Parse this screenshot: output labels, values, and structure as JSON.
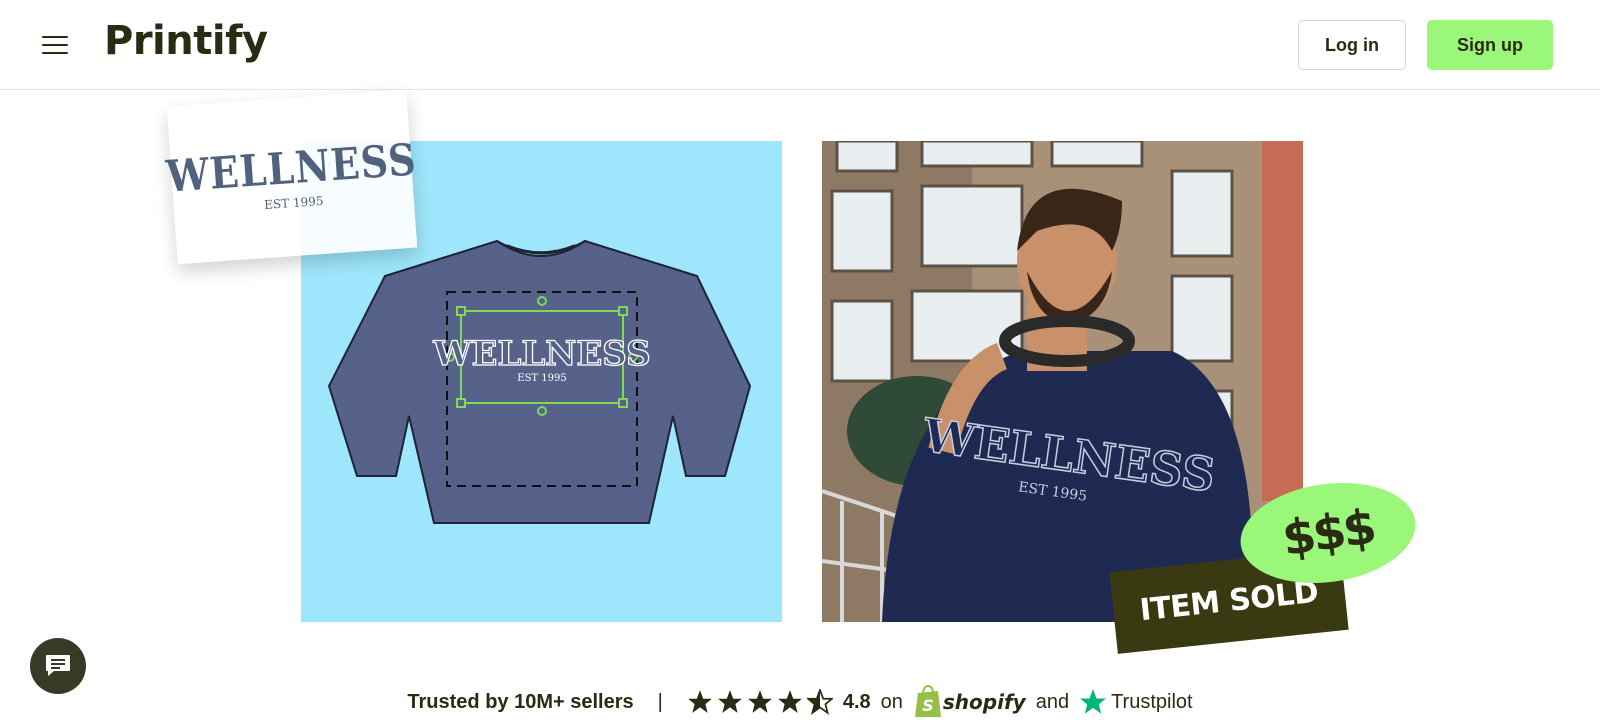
{
  "header": {
    "logo": "Printify",
    "login_label": "Log in",
    "signup_label": "Sign up"
  },
  "design_card": {
    "title": "WELLNESS",
    "subtitle": "EST 1995"
  },
  "sweater_print": {
    "title": "WELLNESS",
    "subtitle": "EST 1995"
  },
  "photo": {
    "shirt_title": "WELLNESS",
    "shirt_subtitle": "EST 1995"
  },
  "badges": {
    "money": "$$$",
    "item_sold": "ITEM SOLD"
  },
  "trust_bar": {
    "trusted_text": "Trusted by 10M+ sellers",
    "separator": "|",
    "rating": "4.8",
    "on_text": "on",
    "shopify": "shopify",
    "and_text": "and",
    "trustpilot": "Trustpilot",
    "stars": 4.5
  },
  "colors": {
    "brand_green": "#9af77a",
    "brand_dark": "#393a12",
    "sky_panel": "#9ee6fb",
    "sweater": "#57628a"
  }
}
